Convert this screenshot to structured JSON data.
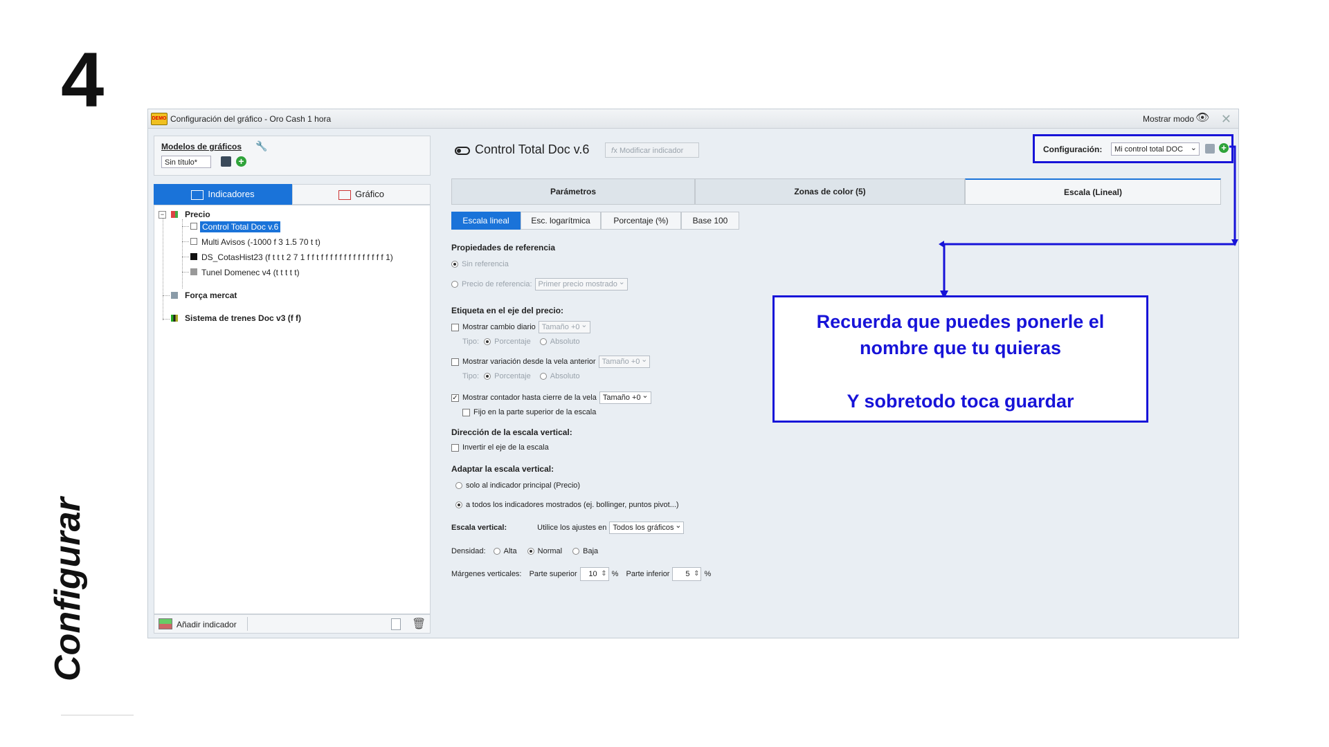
{
  "step_number": "4",
  "side_label": "Configurar",
  "window": {
    "title": "Configuración del gráfico - Oro Cash 1 hora",
    "mode_label": "Mostrar modo"
  },
  "models": {
    "title": "Modelos de gráficos",
    "selected": "Sin título*"
  },
  "left_tabs": {
    "indicators": "Indicadores",
    "chart": "Gráfico"
  },
  "tree": {
    "precio": "Precio",
    "items": [
      "Control Total Doc v.6",
      "Multi Avisos (-1000 f 3 1.5 70 t t)",
      "DS_CotasHist23 (f t t t 2 7 1 f f t f f f f f f f f f f f f f f 1)",
      "Tunel Domenec v4 (t t t t t)"
    ],
    "forca": "Força mercat",
    "sistema": "Sistema de trenes Doc v3 (f f)"
  },
  "bottom": {
    "add_indicator": "Añadir indicador"
  },
  "indicator": {
    "name": "Control Total Doc v.6",
    "modify": "Modificar indicador"
  },
  "config": {
    "label": "Configuración:",
    "selected": "Mi control total DOC"
  },
  "main_tabs": [
    "Parámetros",
    "Zonas de color (5)",
    "Escala (Lineal)"
  ],
  "sub_tabs": [
    "Escala lineal",
    "Esc. logarítmica",
    "Porcentaje (%)",
    "Base 100"
  ],
  "form": {
    "ref_props": "Propiedades de referencia",
    "sin_ref": "Sin referencia",
    "precio_ref": "Precio de referencia:",
    "precio_ref_val": "Primer precio mostrado",
    "etiqueta": "Etiqueta en el eje del precio:",
    "cambio_diario": "Mostrar cambio diario",
    "tamano": "Tamaño +0",
    "tipo": "Tipo:",
    "porcentaje": "Porcentaje",
    "absoluto": "Absoluto",
    "variacion": "Mostrar variación desde la vela anterior",
    "contador": "Mostrar contador hasta cierre de la vela",
    "fijo": "Fijo en la parte superior de la escala",
    "direccion": "Dirección de la escala vertical:",
    "invertir": "Invertir el eje de la escala",
    "adaptar": "Adaptar la escala vertical:",
    "solo": "solo al indicador principal (Precio)",
    "todos": "a todos los indicadores mostrados (ej. bollinger, puntos pivot...)",
    "escala_vertical": "Escala vertical:",
    "utilice": "Utilice los ajustes en",
    "todos_graficos": "Todos los gráficos",
    "densidad": "Densidad:",
    "alta": "Alta",
    "normal": "Normal",
    "baja": "Baja",
    "margenes": "Márgenes verticales:",
    "parte_sup": "Parte superior",
    "sup_val": "10",
    "pct": "%",
    "parte_inf": "Parte inferior",
    "inf_val": "5"
  },
  "callout": {
    "line1": "Recuerda que puedes ponerle el",
    "line2": "nombre que tu quieras",
    "line3": "Y sobretodo toca guardar"
  },
  "colors": {
    "highlight": "#1713d8",
    "accent": "#1a73d9"
  }
}
